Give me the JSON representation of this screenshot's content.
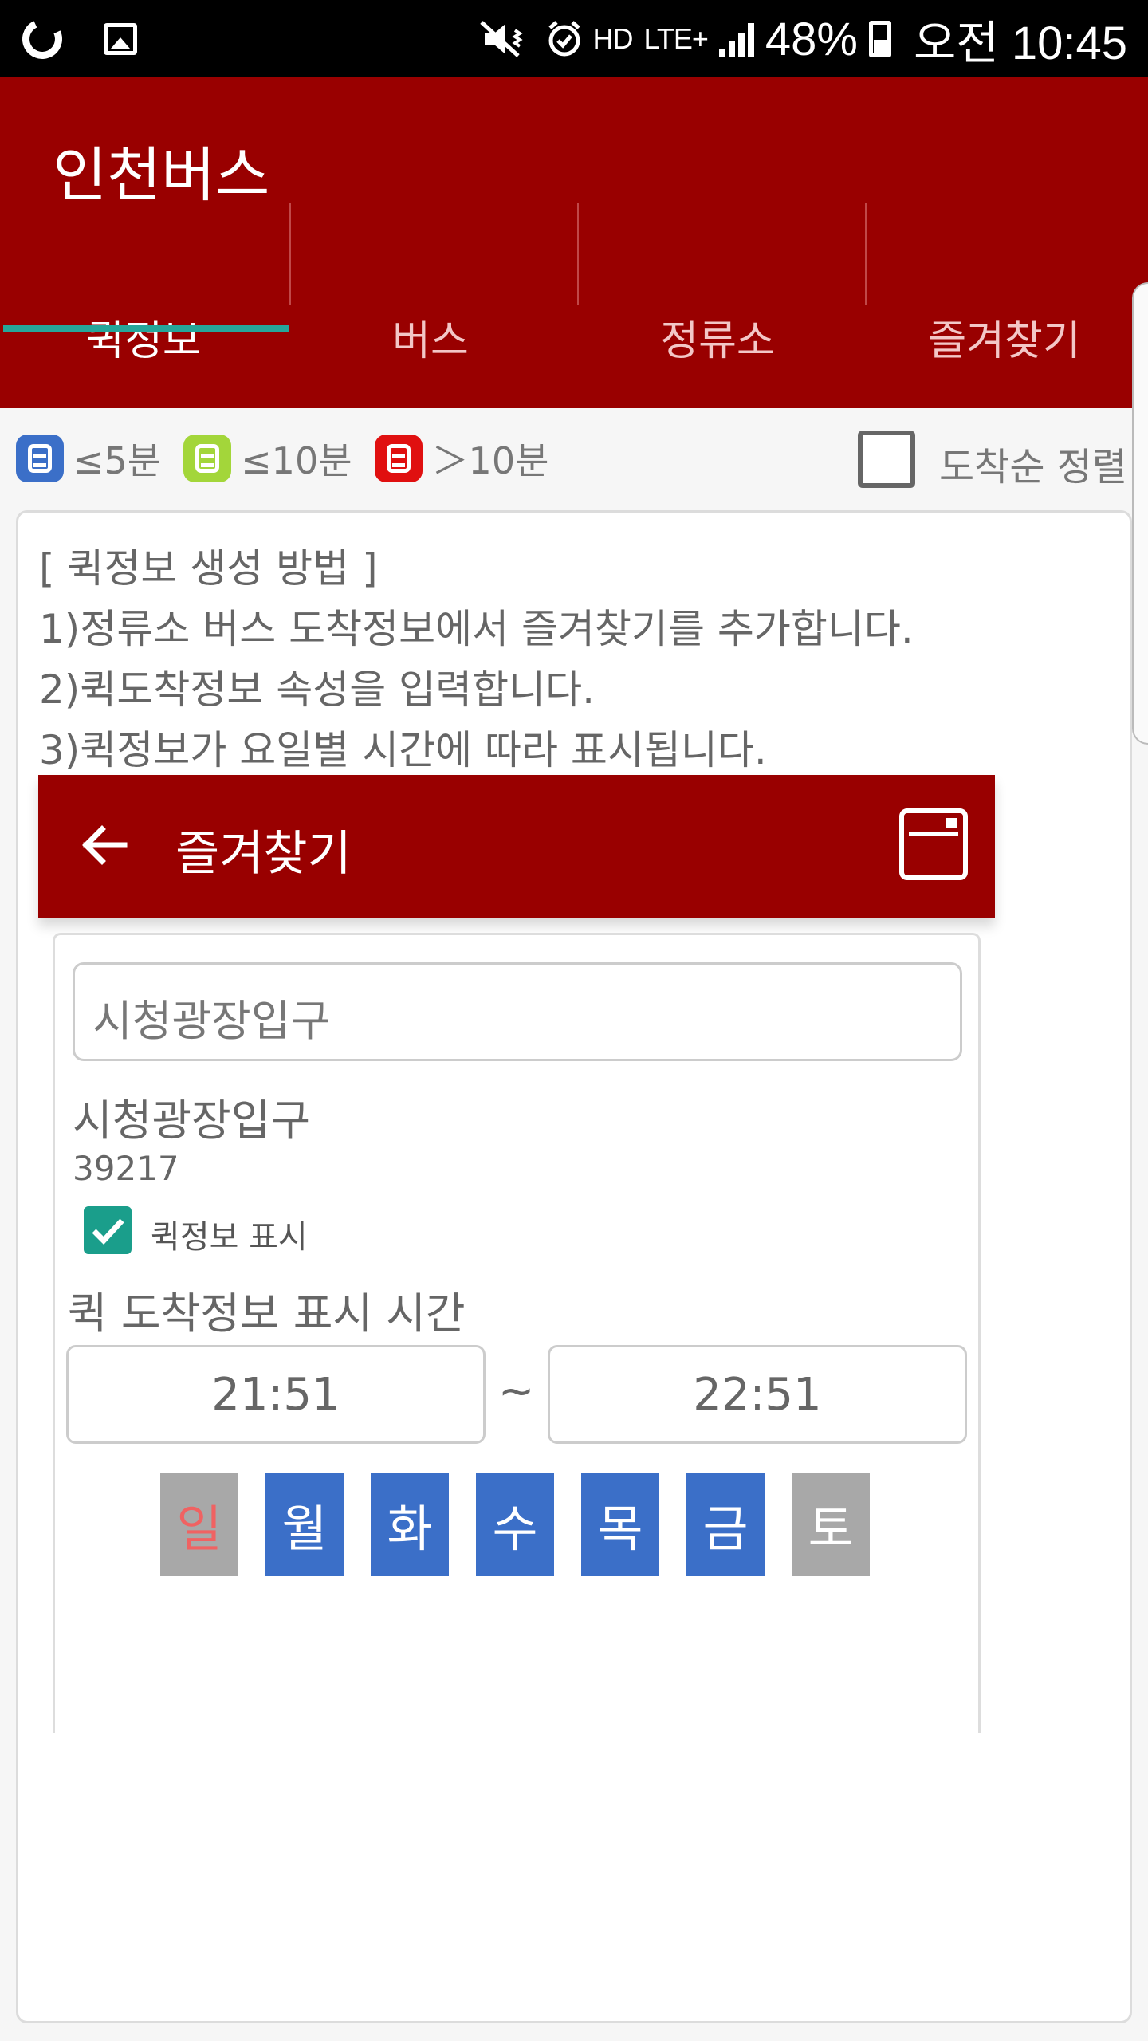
{
  "status_bar": {
    "lte_label": "LTE+",
    "battery_percent": "48%",
    "time": "오전 10:45",
    "hd_label": "HD",
    "icons": [
      "g-app-icon",
      "image-icon",
      "mute-icon",
      "alarm-icon",
      "hd-icon",
      "lte-icon",
      "signal-icon",
      "battery-icon"
    ]
  },
  "app": {
    "title": "인천버스",
    "primary_color": "#990000",
    "accent_color": "#26a69a"
  },
  "tabs": [
    {
      "label": "퀵정보",
      "active": true
    },
    {
      "label": "버스",
      "active": false
    },
    {
      "label": "정류소",
      "active": false
    },
    {
      "label": "즐겨찾기",
      "active": false
    }
  ],
  "legend": {
    "items": [
      {
        "label": "≤5분",
        "color": "#3b6fc8"
      },
      {
        "label": "≤10분",
        "color": "#a3d63a"
      },
      {
        "label": "＞10분",
        "color": "#e01010"
      }
    ],
    "sort_label": "도착순 정렬",
    "sort_checked": false
  },
  "info": {
    "lines": [
      "[ 퀵정보 생성 방법 ]",
      "1)정류소 버스 도착정보에서 즐겨찾기를 추가합니다.",
      "2)퀵도착정보 속성을 입력합니다.",
      "3)퀵정보가 요일별 시간에 따라 표시됩니다."
    ]
  },
  "demo": {
    "title": "즐겨찾기",
    "input_value": "시청광장입구",
    "stop_name": "시청광장입구",
    "stop_code": "39217",
    "quick_info_checked": true,
    "quick_info_label": "퀵정보 표시",
    "time_label": "퀵 도착정보 표시 시간",
    "start_time": "21:51",
    "tilde": "~",
    "end_time": "22:51",
    "days": [
      {
        "label": "일",
        "selected": false
      },
      {
        "label": "월",
        "selected": true
      },
      {
        "label": "화",
        "selected": true
      },
      {
        "label": "수",
        "selected": true
      },
      {
        "label": "목",
        "selected": true
      },
      {
        "label": "금",
        "selected": true
      },
      {
        "label": "토",
        "selected": false
      }
    ]
  }
}
